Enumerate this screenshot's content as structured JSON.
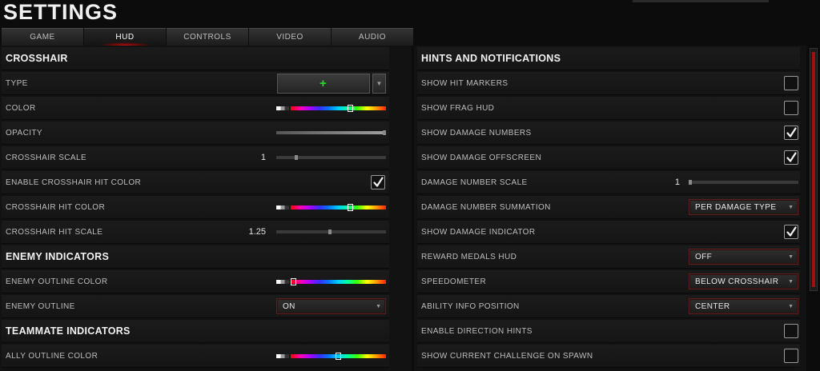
{
  "title": "SETTINGS",
  "tabs": [
    "GAME",
    "HUD",
    "CONTROLS",
    "VIDEO",
    "AUDIO"
  ],
  "active_tab": "HUD",
  "left": {
    "crosshair": {
      "title": "CROSSHAIR",
      "type_label": "TYPE",
      "color_label": "COLOR",
      "opacity_label": "OPACITY",
      "scale_label": "CROSSHAIR SCALE",
      "scale_value": "1",
      "enable_hit_color_label": "ENABLE CROSSHAIR HIT COLOR",
      "hit_color_label": "CROSSHAIR HIT COLOR",
      "hit_scale_label": "CROSSHAIR HIT SCALE",
      "hit_scale_value": "1.25"
    },
    "enemy": {
      "title": "ENEMY INDICATORS",
      "outline_color_label": "ENEMY OUTLINE COLOR",
      "outline_label": "ENEMY OUTLINE",
      "outline_value": "ON"
    },
    "teammate": {
      "title": "TEAMMATE INDICATORS",
      "ally_outline_color_label": "ALLY OUTLINE COLOR"
    }
  },
  "right": {
    "title": "HINTS AND NOTIFICATIONS",
    "show_hit_markers": "SHOW HIT MARKERS",
    "show_frag_hud": "SHOW FRAG HUD",
    "show_damage_numbers": "SHOW DAMAGE NUMBERS",
    "show_damage_offscreen": "SHOW DAMAGE OFFSCREEN",
    "damage_number_scale": "DAMAGE NUMBER SCALE",
    "damage_number_scale_value": "1",
    "damage_number_summation": "DAMAGE NUMBER SUMMATION",
    "damage_number_summation_value": "PER DAMAGE TYPE",
    "show_damage_indicator": "SHOW DAMAGE INDICATOR",
    "reward_medals_hud": "REWARD MEDALS HUD",
    "reward_medals_hud_value": "OFF",
    "speedometer": "SPEEDOMETER",
    "speedometer_value": "BELOW CROSSHAIR",
    "ability_info_position": "ABILITY INFO POSITION",
    "ability_info_position_value": "CENTER",
    "enable_direction_hints": "ENABLE DIRECTION HINTS",
    "show_current_challenge": "SHOW CURRENT CHALLENGE ON SPAWN"
  },
  "state": {
    "crosshair_color_level": 0.63,
    "opacity_level": 1.0,
    "crosshair_scale_level": 0.2,
    "crosshair_hit_color_level": 0.63,
    "crosshair_hit_scale_level": 0.5,
    "enemy_outline_color_level": 0.0,
    "ally_outline_color_level": 0.5,
    "damage_number_scale_level": 0.02,
    "enable_crosshair_hit_color": true,
    "show_hit_markers": false,
    "show_frag_hud": false,
    "show_damage_numbers": true,
    "show_damage_offscreen": true,
    "show_damage_indicator": true,
    "enable_direction_hints": false,
    "show_current_challenge": false
  },
  "colors": {
    "accent": "#b01010",
    "crosshair_green": "#22e02a"
  },
  "icons": [
    "check-icon",
    "chevron-down-icon",
    "crosshair-icon"
  ]
}
